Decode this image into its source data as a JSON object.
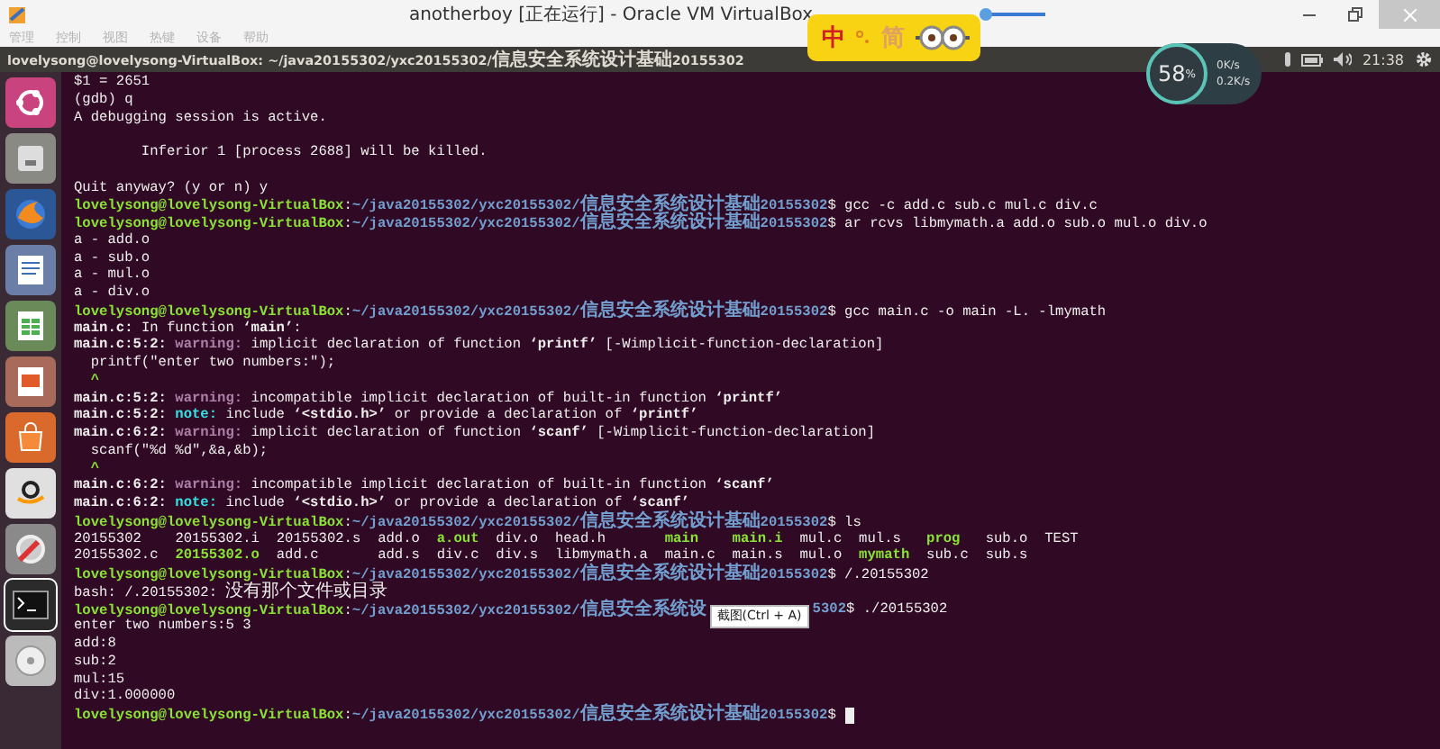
{
  "window": {
    "title": "anotherboy [正在运行] - Oracle VM VirtualBox"
  },
  "menu": [
    "管理",
    "控制",
    "视图",
    "热键",
    "设备",
    "帮助"
  ],
  "top_bar": {
    "title": "lovelysong@lovelysong-VirtualBox: ~/java20155302/yxc20155302/信息安全系统设计基础20155302",
    "time": "21:38"
  },
  "ime": {
    "mode": "中",
    "script": "简"
  },
  "net_widget": {
    "percent": "58",
    "unit": "%",
    "down": "0K/s",
    "up": "0.2K/s"
  },
  "launcher": [
    {
      "kind": "ubuntu",
      "selected": false
    },
    {
      "kind": "files",
      "selected": false
    },
    {
      "kind": "browser",
      "selected": false
    },
    {
      "kind": "writer",
      "selected": false
    },
    {
      "kind": "calc",
      "selected": false
    },
    {
      "kind": "impress",
      "selected": false
    },
    {
      "kind": "store",
      "selected": false
    },
    {
      "kind": "amazon",
      "selected": false
    },
    {
      "kind": "settings",
      "selected": false
    },
    {
      "kind": "terminal",
      "selected": true
    },
    {
      "kind": "disc",
      "selected": false
    }
  ],
  "terminal": {
    "lines": [
      {
        "kind": "text",
        "segments": [
          {
            "kind": "plain",
            "text": "$1 = 2651"
          }
        ]
      },
      {
        "kind": "text",
        "segments": [
          {
            "kind": "plain",
            "text": "(gdb) q"
          }
        ]
      },
      {
        "kind": "text",
        "segments": [
          {
            "kind": "plain",
            "text": "A debugging session is active."
          }
        ]
      },
      {
        "kind": "blank"
      },
      {
        "kind": "text",
        "segments": [
          {
            "kind": "plain",
            "text": "        Inferior 1 [process 2688] will be killed."
          }
        ]
      },
      {
        "kind": "blank"
      },
      {
        "kind": "text",
        "segments": [
          {
            "kind": "plain",
            "text": "Quit anyway? (y or n) y"
          }
        ]
      },
      {
        "kind": "text",
        "segments": [
          {
            "kind": "user",
            "text": "lovelysong@lovelysong-VirtualBox"
          },
          {
            "kind": "plain",
            "text": ":"
          },
          {
            "kind": "path",
            "text": "~/java20155302/yxc20155302/信息安全系统设计基础20155302"
          },
          {
            "kind": "plain",
            "text": "$ gcc -c add.c sub.c mul.c div.c"
          }
        ]
      },
      {
        "kind": "text",
        "segments": [
          {
            "kind": "user",
            "text": "lovelysong@lovelysong-VirtualBox"
          },
          {
            "kind": "plain",
            "text": ":"
          },
          {
            "kind": "path",
            "text": "~/java20155302/yxc20155302/信息安全系统设计基础20155302"
          },
          {
            "kind": "plain",
            "text": "$ ar rcvs libmymath.a add.o sub.o mul.o div.o"
          }
        ]
      },
      {
        "kind": "text",
        "segments": [
          {
            "kind": "plain",
            "text": "a - add.o"
          }
        ]
      },
      {
        "kind": "text",
        "segments": [
          {
            "kind": "plain",
            "text": "a - sub.o"
          }
        ]
      },
      {
        "kind": "text",
        "segments": [
          {
            "kind": "plain",
            "text": "a - mul.o"
          }
        ]
      },
      {
        "kind": "text",
        "segments": [
          {
            "kind": "plain",
            "text": "a - div.o"
          }
        ]
      },
      {
        "kind": "text",
        "segments": [
          {
            "kind": "user",
            "text": "lovelysong@lovelysong-VirtualBox"
          },
          {
            "kind": "plain",
            "text": ":"
          },
          {
            "kind": "path",
            "text": "~/java20155302/yxc20155302/信息安全系统设计基础20155302"
          },
          {
            "kind": "plain",
            "text": "$ gcc main.c -o main -L. -lmymath"
          }
        ]
      },
      {
        "kind": "text",
        "segments": [
          {
            "kind": "bold",
            "text": "main.c:"
          },
          {
            "kind": "plain",
            "text": " In function "
          },
          {
            "kind": "bold",
            "text": "‘main’"
          },
          {
            "kind": "plain",
            "text": ":"
          }
        ]
      },
      {
        "kind": "text",
        "segments": [
          {
            "kind": "bold",
            "text": "main.c:5:2:"
          },
          {
            "kind": "warning",
            "text": " warning:"
          },
          {
            "kind": "plain",
            "text": " implicit declaration of function "
          },
          {
            "kind": "bold",
            "text": "‘printf’"
          },
          {
            "kind": "plain",
            "text": " [-Wimplicit-function-declaration]"
          }
        ]
      },
      {
        "kind": "text",
        "segments": [
          {
            "kind": "plain",
            "text": "  printf(\"enter two numbers:\");"
          }
        ]
      },
      {
        "kind": "text",
        "segments": [
          {
            "kind": "caret",
            "text": "  ^"
          }
        ]
      },
      {
        "kind": "text",
        "segments": [
          {
            "kind": "bold",
            "text": "main.c:5:2:"
          },
          {
            "kind": "warning",
            "text": " warning:"
          },
          {
            "kind": "plain",
            "text": " incompatible implicit declaration of built-in function "
          },
          {
            "kind": "bold",
            "text": "‘printf’"
          }
        ]
      },
      {
        "kind": "text",
        "segments": [
          {
            "kind": "bold",
            "text": "main.c:5:2:"
          },
          {
            "kind": "note",
            "text": " note:"
          },
          {
            "kind": "plain",
            "text": " include "
          },
          {
            "kind": "bold",
            "text": "‘<stdio.h>’"
          },
          {
            "kind": "plain",
            "text": " or provide a declaration of "
          },
          {
            "kind": "bold",
            "text": "‘printf’"
          }
        ]
      },
      {
        "kind": "text",
        "segments": [
          {
            "kind": "bold",
            "text": "main.c:6:2:"
          },
          {
            "kind": "warning",
            "text": " warning:"
          },
          {
            "kind": "plain",
            "text": " implicit declaration of function "
          },
          {
            "kind": "bold",
            "text": "‘scanf’"
          },
          {
            "kind": "plain",
            "text": " [-Wimplicit-function-declaration]"
          }
        ]
      },
      {
        "kind": "text",
        "segments": [
          {
            "kind": "plain",
            "text": "  scanf(\"%d %d\",&a,&b);"
          }
        ]
      },
      {
        "kind": "text",
        "segments": [
          {
            "kind": "caret",
            "text": "  ^"
          }
        ]
      },
      {
        "kind": "text",
        "segments": [
          {
            "kind": "bold",
            "text": "main.c:6:2:"
          },
          {
            "kind": "warning",
            "text": " warning:"
          },
          {
            "kind": "plain",
            "text": " incompatible implicit declaration of built-in function "
          },
          {
            "kind": "bold",
            "text": "‘scanf’"
          }
        ]
      },
      {
        "kind": "text",
        "segments": [
          {
            "kind": "bold",
            "text": "main.c:6:2:"
          },
          {
            "kind": "note",
            "text": " note:"
          },
          {
            "kind": "plain",
            "text": " include "
          },
          {
            "kind": "bold",
            "text": "‘<stdio.h>’"
          },
          {
            "kind": "plain",
            "text": " or provide a declaration of "
          },
          {
            "kind": "bold",
            "text": "‘scanf’"
          }
        ]
      },
      {
        "kind": "text",
        "segments": [
          {
            "kind": "user",
            "text": "lovelysong@lovelysong-VirtualBox"
          },
          {
            "kind": "plain",
            "text": ":"
          },
          {
            "kind": "path",
            "text": "~/java20155302/yxc20155302/信息安全系统设计基础20155302"
          },
          {
            "kind": "plain",
            "text": "$ ls"
          }
        ]
      },
      {
        "kind": "listing",
        "rows": [
          [
            {
              "text": "20155302",
              "exec": false
            },
            {
              "text": "20155302.i",
              "exec": false
            },
            {
              "text": "20155302.s",
              "exec": false
            },
            {
              "text": "add.o",
              "exec": false
            },
            {
              "text": "a.out",
              "exec": true
            },
            {
              "text": "div.o",
              "exec": false
            },
            {
              "text": "head.h",
              "exec": false
            },
            {
              "text": "main",
              "exec": true
            },
            {
              "text": "main.i",
              "exec": true
            },
            {
              "text": "mul.c",
              "exec": false
            },
            {
              "text": "mul.s",
              "exec": false
            },
            {
              "text": "prog",
              "exec": true
            },
            {
              "text": "sub.o",
              "exec": false
            },
            {
              "text": "TEST",
              "exec": false
            }
          ],
          [
            {
              "text": "20155302.c",
              "exec": false
            },
            {
              "text": "20155302.o",
              "exec": true
            },
            {
              "text": "add.c",
              "exec": false
            },
            {
              "text": "add.s",
              "exec": false
            },
            {
              "text": "div.c",
              "exec": false
            },
            {
              "text": "div.s",
              "exec": false
            },
            {
              "text": "libmymath.a",
              "exec": false
            },
            {
              "text": "main.c",
              "exec": false
            },
            {
              "text": "main.s",
              "exec": false
            },
            {
              "text": "mul.o",
              "exec": false
            },
            {
              "text": "mymath",
              "exec": true
            },
            {
              "text": "sub.c",
              "exec": false
            },
            {
              "text": "sub.s",
              "exec": false
            }
          ]
        ]
      },
      {
        "kind": "text",
        "segments": [
          {
            "kind": "user",
            "text": "lovelysong@lovelysong-VirtualBox"
          },
          {
            "kind": "plain",
            "text": ":"
          },
          {
            "kind": "path",
            "text": "~/java20155302/yxc20155302/信息安全系统设计基础20155302"
          },
          {
            "kind": "plain",
            "text": "$ /.20155302"
          }
        ]
      },
      {
        "kind": "text",
        "segments": [
          {
            "kind": "plain",
            "text": "bash: /.20155302: 没有那个文件或目录"
          }
        ]
      },
      {
        "kind": "text",
        "segments": [
          {
            "kind": "user",
            "text": "lovelysong@lovelysong-VirtualBox"
          },
          {
            "kind": "plain",
            "text": ":"
          },
          {
            "kind": "path",
            "text": "~/java20155302/yxc20155302/信息安全系统设"
          },
          {
            "kind": "tooltip",
            "text": "截图(Ctrl + A)"
          },
          {
            "kind": "path",
            "text": "5302"
          },
          {
            "kind": "plain",
            "text": "$ ./20155302"
          }
        ]
      },
      {
        "kind": "text",
        "segments": [
          {
            "kind": "plain",
            "text": "enter two numbers:5 3"
          }
        ]
      },
      {
        "kind": "text",
        "segments": [
          {
            "kind": "plain",
            "text": "add:8"
          }
        ]
      },
      {
        "kind": "text",
        "segments": [
          {
            "kind": "plain",
            "text": "sub:2"
          }
        ]
      },
      {
        "kind": "text",
        "segments": [
          {
            "kind": "plain",
            "text": "mul:15"
          }
        ]
      },
      {
        "kind": "text",
        "segments": [
          {
            "kind": "plain",
            "text": "div:1.000000"
          }
        ]
      },
      {
        "kind": "text",
        "cursor": true,
        "segments": [
          {
            "kind": "user",
            "text": "lovelysong@lovelysong-VirtualBox"
          },
          {
            "kind": "plain",
            "text": ":"
          },
          {
            "kind": "path",
            "text": "~/java20155302/yxc20155302/信息安全系统设计基础20155302"
          },
          {
            "kind": "plain",
            "text": "$ "
          }
        ]
      }
    ]
  }
}
